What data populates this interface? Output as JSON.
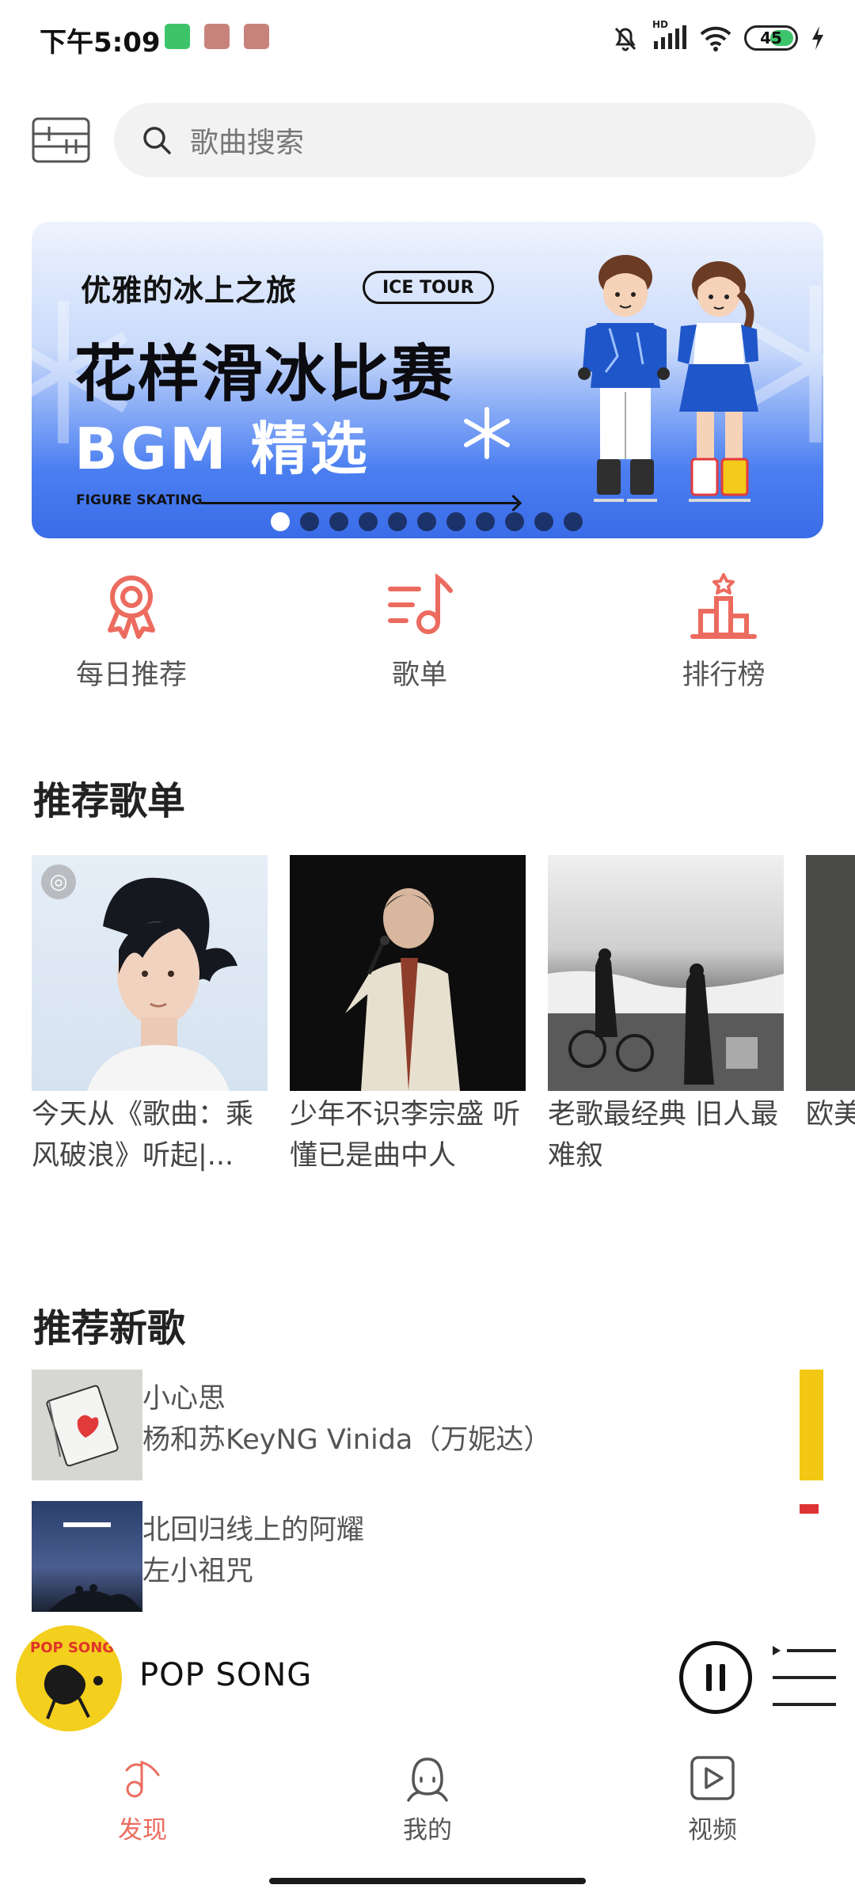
{
  "status_bar": {
    "time": "下午5:09",
    "hd_label": "HD",
    "battery_level": "45"
  },
  "header": {
    "search_placeholder": "歌曲搜索",
    "icons": [
      "menu-icon",
      "search-icon"
    ]
  },
  "banner": {
    "subtitle": "优雅的冰上之旅",
    "pill": "ICE TOUR",
    "title": "花样滑冰比赛",
    "subtitle2": "BGM 精选",
    "caption": "FIGURE SKATING",
    "dot_count": 11,
    "active_dot": 0
  },
  "quick_entries": [
    {
      "label": "每日推荐",
      "icon": "award-ribbon-icon"
    },
    {
      "label": "歌单",
      "icon": "playlist-icon"
    },
    {
      "label": "排行榜",
      "icon": "ranking-podium-icon"
    }
  ],
  "sections": {
    "playlists_title": "推荐歌单",
    "new_songs_title": "推荐新歌"
  },
  "playlists": [
    {
      "title": "今天从《歌曲：乘风破浪》听起|..."
    },
    {
      "title": "少年不识李宗盛 听懂已是曲中人"
    },
    {
      "title": "老歌最经典 旧人最难叙"
    },
    {
      "title": "欧美开"
    }
  ],
  "new_songs": [
    {
      "name": "小心思",
      "artist": "杨和苏KeyNG Vinida（万妮达）"
    },
    {
      "name": "北回归线上的阿耀",
      "artist": "左小祖咒"
    }
  ],
  "player": {
    "title": "POP SONG",
    "disc_text": "POP SONG",
    "state": "playing"
  },
  "bottom_nav": [
    {
      "label": "发现",
      "icon": "music-note-icon",
      "active": true
    },
    {
      "label": "我的",
      "icon": "user-icon",
      "active": false
    },
    {
      "label": "视频",
      "icon": "video-play-icon",
      "active": false
    }
  ],
  "colors": {
    "accent": "#ec6b5f",
    "banner_blue": "#3a6ce8",
    "search_bg": "#f2f2f2"
  }
}
